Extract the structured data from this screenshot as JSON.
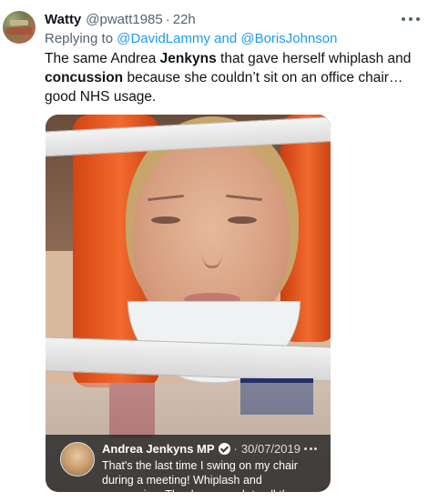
{
  "tweet": {
    "author_name": "Watty",
    "handle": "@pwatt1985",
    "separator": "·",
    "time": "22h",
    "reply_prefix": "Replying to",
    "reply_mention_1": "@DavidLammy",
    "reply_and": "and",
    "reply_mention_2": "@BorisJohnson",
    "text_part1": "The same Andrea ",
    "text_bold1": "Jenkyns",
    "text_part2": " that gave herself whiplash and ",
    "text_bold2": "concussion",
    "text_part3": " because she couldn’t sit on an office chair…good NHS usage."
  },
  "quoted_tweet": {
    "author_name": "Andrea Jenkyns MP",
    "separator": "·",
    "date": "30/07/2019",
    "text": "That's the last time I swing on my chair during a meeting! Whiplash and concussion. Thanks so much to all the"
  },
  "icons": {
    "more": "more-horizontal-icon",
    "verified": "verified-badge-icon"
  },
  "colors": {
    "link": "#1d9bf0",
    "secondary_text": "#536471",
    "primary_text": "#0f1419"
  }
}
